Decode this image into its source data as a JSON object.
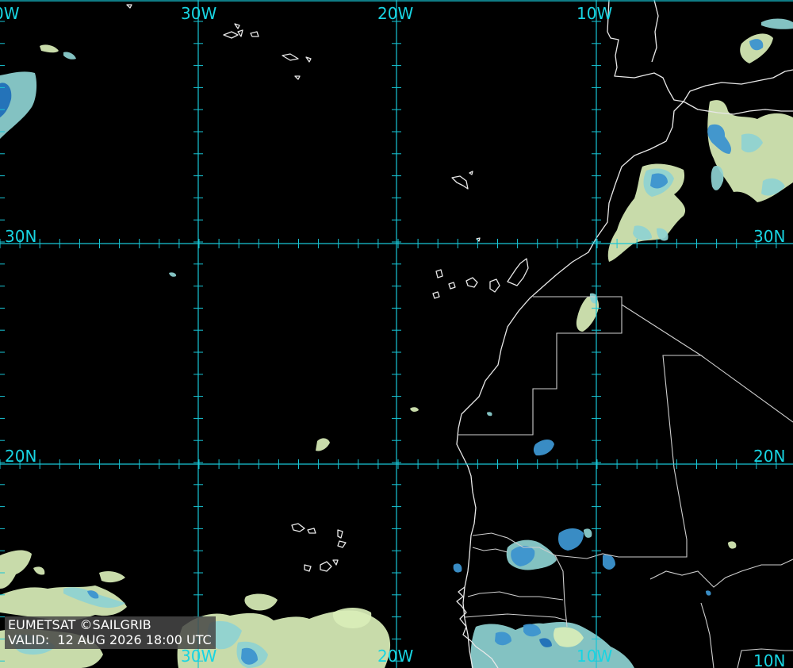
{
  "credit": {
    "source": "EUMETSAT ©SAILGRIB",
    "valid_prefix": "VALID:  ",
    "valid_time": "12 AUG 2026 18:00 UTC"
  },
  "grid": {
    "longitude_labels": [
      "0W",
      "30W",
      "20W",
      "10W",
      "30W",
      "20W",
      "10W",
      "10N"
    ],
    "latitude_labels": [
      "30N",
      "30N",
      "20N",
      "20N"
    ]
  },
  "colors": {
    "gridline": "#18c6d6",
    "background": "#000000",
    "coastline": "#e8e8e8",
    "cloud_light": "#d9eeb8",
    "cloud_mid": "#8ed3d2",
    "cloud_deep": "#1f6fb8"
  }
}
